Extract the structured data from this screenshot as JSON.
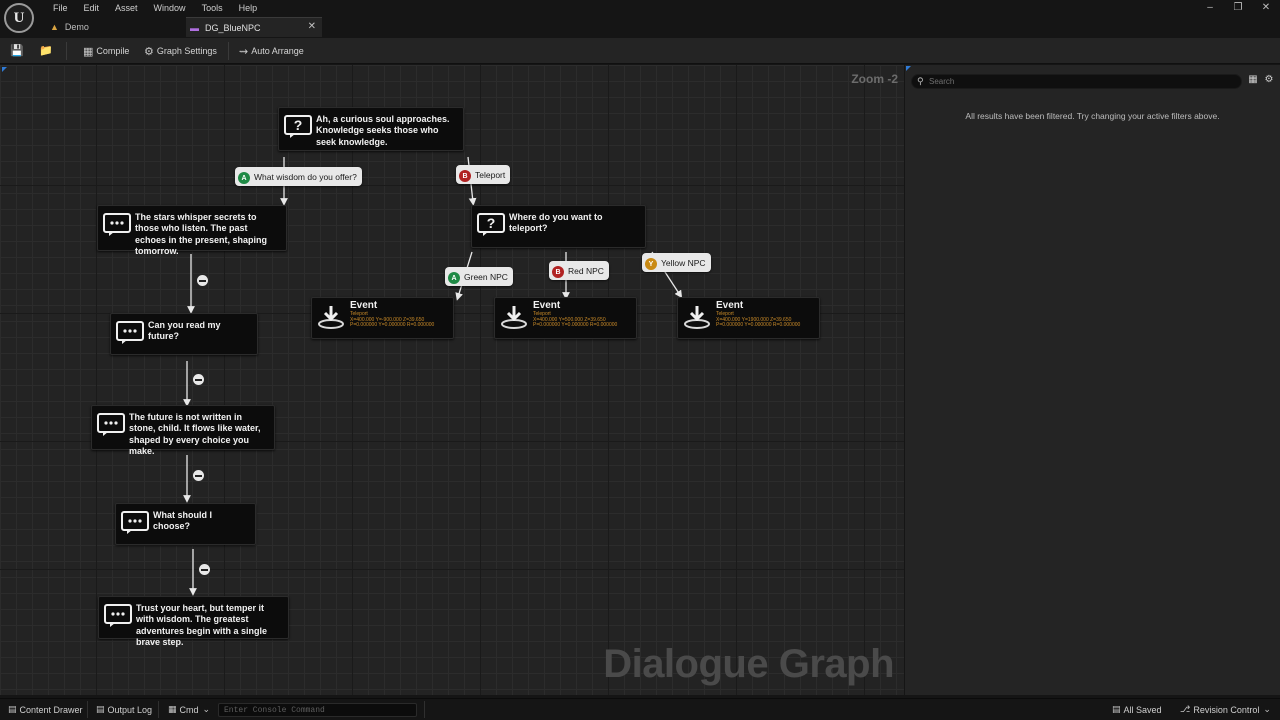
{
  "app": {
    "logo": "U",
    "menu": [
      "File",
      "Edit",
      "Asset",
      "Window",
      "Tools",
      "Help"
    ],
    "window_controls": [
      "–",
      "❐",
      "✕"
    ]
  },
  "tabs": [
    {
      "label": "Demo",
      "active": false
    },
    {
      "label": "DG_BlueNPC",
      "active": true
    }
  ],
  "toolbar": {
    "compile": "Compile",
    "graph_settings": "Graph Settings",
    "auto_arrange": "Auto Arrange"
  },
  "graph": {
    "zoom": "Zoom -2",
    "watermark": "Dialogue Graph",
    "nodes": {
      "root_question": "Ah, a curious soul approaches. Knowledge seeks those who seek knowledge.",
      "stars": "The stars whisper secrets to those who listen. The past echoes in the present, shaping tomorrow.",
      "read_future": "Can you read my future?",
      "future_not_written": "The future is not written in stone, child. It flows like water, shaped by every choice you make.",
      "what_choose": "What should I choose?",
      "trust_heart": "Trust your heart, but temper it with wisdom. The greatest adventures begin with a single brave step.",
      "teleport_question": "Where do you want to teleport?"
    },
    "choices": {
      "wisdom": {
        "badge": "A",
        "label": "What wisdom do you offer?"
      },
      "teleport": {
        "badge": "B",
        "label": "Teleport"
      },
      "green": {
        "badge": "A",
        "label": "Green NPC"
      },
      "red": {
        "badge": "B",
        "label": "Red NPC"
      },
      "yellow": {
        "badge": "Y",
        "label": "Yellow NPC"
      }
    },
    "events": [
      {
        "title": "Event",
        "type": "Teleport",
        "loc": "X=400.000 Y=-900.000 Z=39.650",
        "rot": "P=0.000000 Y=0.000000 R=0.000000"
      },
      {
        "title": "Event",
        "type": "Teleport",
        "loc": "X=400.000 Y=500.000 Z=39.650",
        "rot": "P=0.000000 Y=0.000000 R=0.000000"
      },
      {
        "title": "Event",
        "type": "Teleport",
        "loc": "X=400.000 Y=1900.000 Z=39.650",
        "rot": "P=0.000000 Y=0.000000 R=0.000000"
      }
    ]
  },
  "details": {
    "search_placeholder": "Search",
    "message": "All results have been filtered. Try changing your active filters above."
  },
  "statusbar": {
    "content_drawer": "Content Drawer",
    "output_log": "Output Log",
    "cmd": "Cmd",
    "console_placeholder": "Enter Console Command",
    "saved": "All Saved",
    "revision": "Revision Control"
  },
  "colors": {
    "accent_blue": "#2f7bd6",
    "badge_a": "#1f8a45",
    "badge_b": "#b12323",
    "badge_y": "#c98a14",
    "event_sub": "#c98a28"
  }
}
